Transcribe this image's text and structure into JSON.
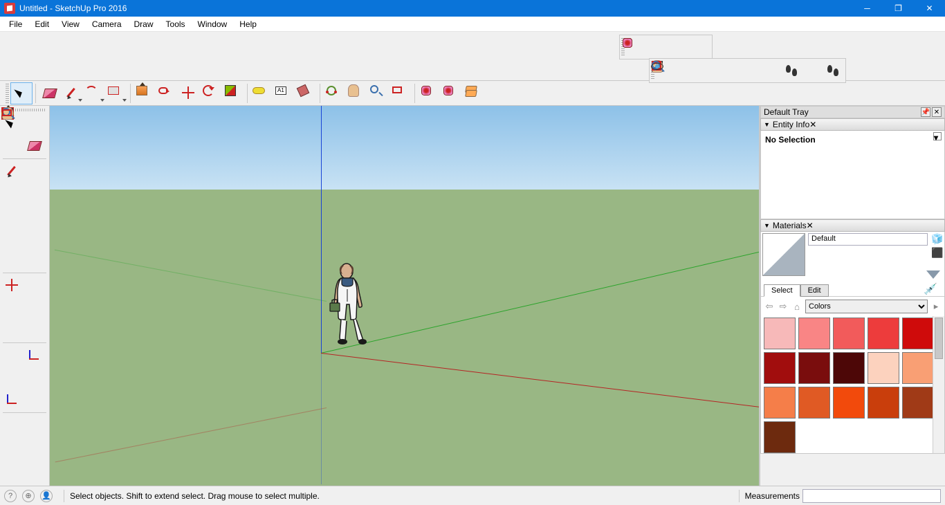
{
  "titlebar": {
    "title": "Untitled - SketchUp Pro 2016"
  },
  "menubar": [
    "File",
    "Edit",
    "View",
    "Camera",
    "Draw",
    "Tools",
    "Window",
    "Help"
  ],
  "statusbar": {
    "hint": "Select objects. Shift to extend select. Drag mouse to select multiple.",
    "measurements_label": "Measurements",
    "measurements_value": ""
  },
  "tray": {
    "title": "Default Tray",
    "entity": {
      "title": "Entity Info",
      "no_selection": "No Selection"
    },
    "materials": {
      "title": "Materials",
      "current_name": "Default",
      "tabs": {
        "select": "Select",
        "edit": "Edit"
      },
      "collection_dropdown": "Colors",
      "swatches": [
        "#f7b9b9",
        "#f98585",
        "#f25b5b",
        "#ed3c3c",
        "#cf0b0b",
        "#a10d0d",
        "#7a0d0d",
        "#4d0707",
        "#fcd2be",
        "#f99f74",
        "#f57e49",
        "#e05a24",
        "#f24a0c",
        "#c93e0c",
        "#a03a17",
        "#6d2a0e"
      ]
    }
  },
  "palette_top": [
    {
      "n": "warehouse-send-icon",
      "g": "g-ware"
    },
    {
      "n": "warehouse-get-icon",
      "g": "g-ware"
    },
    {
      "n": "warehouse-share-icon",
      "g": "g-ware"
    },
    {
      "n": "warehouse-ext-icon",
      "g": "g-ware"
    }
  ],
  "palette_top2": [
    {
      "n": "section-plane-icon",
      "g": "g-sect"
    },
    {
      "n": "pan-icon",
      "g": "g-pan"
    },
    {
      "n": "zoom-icon",
      "g": "g-zoom"
    },
    {
      "n": "zoom-window-icon",
      "g": "g-zoome"
    },
    {
      "n": "zoom-extents-icon",
      "g": "g-zoomw"
    },
    {
      "n": "previous-view-icon",
      "g": "g-prev"
    },
    {
      "n": "position-camera-icon",
      "g": "g-walk"
    },
    {
      "n": "look-around-icon",
      "g": "g-eye"
    },
    {
      "n": "walk-icon",
      "g": "g-walk"
    }
  ],
  "maintool": [
    {
      "n": "select-tool",
      "g": "g-cursor",
      "sel": true
    },
    {
      "n": "sep"
    },
    {
      "n": "eraser-tool",
      "g": "g-eraser"
    },
    {
      "n": "line-tool",
      "g": "g-pen",
      "dd": true
    },
    {
      "n": "arc-tool",
      "g": "g-arc",
      "dd": true
    },
    {
      "n": "rectangle-tool",
      "g": "g-rect",
      "dd": true
    },
    {
      "n": "sep"
    },
    {
      "n": "pushpull-tool",
      "g": "g-push"
    },
    {
      "n": "followme-tool",
      "g": "g-follow"
    },
    {
      "n": "move-tool",
      "g": "g-move"
    },
    {
      "n": "rotate-tool",
      "g": "g-rotate"
    },
    {
      "n": "scale-tool",
      "g": "g-scale"
    },
    {
      "n": "sep"
    },
    {
      "n": "tape-tool",
      "g": "g-tape"
    },
    {
      "n": "text-tool",
      "g": "g-text"
    },
    {
      "n": "paint-tool",
      "g": "g-paint"
    },
    {
      "n": "sep"
    },
    {
      "n": "orbit-tool",
      "g": "g-orbit"
    },
    {
      "n": "pan-tool",
      "g": "g-pan"
    },
    {
      "n": "zoom-tool",
      "g": "g-zoom"
    },
    {
      "n": "zoom-extents-tool",
      "g": "g-zoomw"
    },
    {
      "n": "sep"
    },
    {
      "n": "warehouse-1",
      "g": "g-ware"
    },
    {
      "n": "warehouse-2",
      "g": "g-ware"
    },
    {
      "n": "layers-tool",
      "g": "g-layers"
    }
  ],
  "sidebar": [
    {
      "n": "grip"
    },
    {
      "n": "select-tool",
      "g": "g-cursor"
    },
    {
      "n": "make-component",
      "g": "g-cube"
    },
    {
      "n": "paint-bucket",
      "g": "g-paint"
    },
    {
      "n": "eraser-tool",
      "g": "g-eraser"
    },
    {
      "n": "hsep"
    },
    {
      "n": "line-tool",
      "g": "g-pen"
    },
    {
      "n": "freehand-tool",
      "g": "g-freehand"
    },
    {
      "n": "rectangle-tool",
      "g": "g-rect"
    },
    {
      "n": "rotated-rect-tool",
      "g": "g-rect"
    },
    {
      "n": "circle-tool",
      "g": "g-circle"
    },
    {
      "n": "polygon-tool",
      "g": "g-poly"
    },
    {
      "n": "arc-tool",
      "g": "g-arc"
    },
    {
      "n": "arc2-tool",
      "g": "g-arc"
    },
    {
      "n": "arc3-tool",
      "g": "g-arc"
    },
    {
      "n": "pie-tool",
      "g": "g-arc"
    },
    {
      "n": "hsep"
    },
    {
      "n": "move-tool",
      "g": "g-move"
    },
    {
      "n": "pushpull-tool",
      "g": "g-push"
    },
    {
      "n": "rotate-tool",
      "g": "g-rotate"
    },
    {
      "n": "followme-tool",
      "g": "g-follow"
    },
    {
      "n": "scale-tool",
      "g": "g-scale"
    },
    {
      "n": "offset-tool",
      "g": "g-offset"
    },
    {
      "n": "hsep"
    },
    {
      "n": "tape-tool",
      "g": "g-tape"
    },
    {
      "n": "dimension-tool",
      "g": "g-axes"
    },
    {
      "n": "protractor-tool",
      "g": "g-protract"
    },
    {
      "n": "text-tool",
      "g": "g-text"
    },
    {
      "n": "axes-tool",
      "g": "g-axes"
    },
    {
      "n": "3dtext-tool",
      "g": "g-3dtext"
    },
    {
      "n": "hsep"
    },
    {
      "n": "orbit-tool",
      "g": "g-orbit"
    },
    {
      "n": "pan-tool",
      "g": "g-pan"
    },
    {
      "n": "zoom-tool",
      "g": "g-zoom"
    },
    {
      "n": "zoom-extents-tool",
      "g": "g-zoomw"
    }
  ]
}
